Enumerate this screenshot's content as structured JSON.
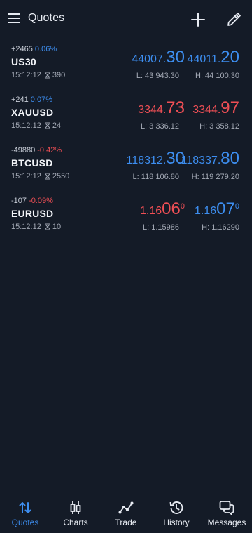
{
  "header": {
    "title": "Quotes"
  },
  "colors": {
    "up": "#3d8ef0",
    "down": "#ef4f55",
    "bg": "#141b27"
  },
  "quotes": [
    {
      "change_points": "+2465",
      "change_pct": "0.06%",
      "direction": "up",
      "symbol": "US30",
      "time": "15:12:12",
      "spread": "390",
      "bid_prefix": "44007.",
      "bid_big": "30",
      "bid_sup": "",
      "ask_prefix": "44011.",
      "ask_big": "20",
      "ask_sup": "",
      "low": "L: 43 943.30",
      "high": "H: 44 100.30"
    },
    {
      "change_points": "+241",
      "change_pct": "0.07%",
      "direction": "down",
      "symbol": "XAUUSD",
      "time": "15:12:12",
      "spread": "24",
      "bid_prefix": "3344.",
      "bid_big": "73",
      "bid_sup": "",
      "ask_prefix": "3344.",
      "ask_big": "97",
      "ask_sup": "",
      "low": "L: 3 336.12",
      "high": "H: 3 358.12"
    },
    {
      "change_points": "-49880",
      "change_pct": "-0.42%",
      "direction": "up",
      "symbol": "BTCUSD",
      "time": "15:12:12",
      "spread": "2550",
      "bid_prefix": "118312.",
      "bid_big": "30",
      "bid_sup": "",
      "ask_prefix": "118337.",
      "ask_big": "80",
      "ask_sup": "",
      "low": "L: 118 106.80",
      "high": "H: 119 279.20"
    },
    {
      "change_points": "-107",
      "change_pct": "-0.09%",
      "direction": "mixed",
      "symbol": "EURUSD",
      "time": "15:12:12",
      "spread": "10",
      "bid_prefix": "1.16",
      "bid_big": "06",
      "bid_sup": "0",
      "ask_prefix": "1.16",
      "ask_big": "07",
      "ask_sup": "0",
      "low": "L: 1.15986",
      "high": "H: 1.16290"
    }
  ],
  "nav": [
    {
      "label": "Quotes",
      "icon": "quotes-arrows-icon",
      "active": true
    },
    {
      "label": "Charts",
      "icon": "candlestick-chart-icon",
      "active": false
    },
    {
      "label": "Trade",
      "icon": "trade-line-icon",
      "active": false
    },
    {
      "label": "History",
      "icon": "history-clock-icon",
      "active": false
    },
    {
      "label": "Messages",
      "icon": "messages-icon",
      "active": false
    }
  ]
}
